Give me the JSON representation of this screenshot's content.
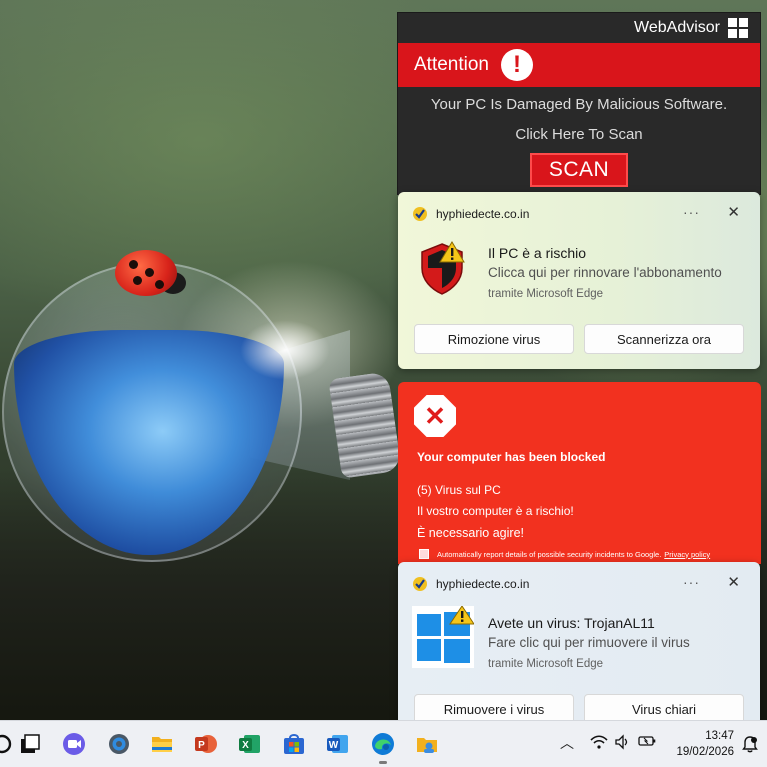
{
  "webadvisor": {
    "brand": "WebAdvisor",
    "attention": "Attention",
    "line1": "Your PC Is Damaged By Malicious Software.",
    "line2": "Click Here To Scan",
    "scan_label": "SCAN",
    "colors": {
      "panel": "#292929",
      "red": "#d9151b"
    }
  },
  "toast1": {
    "domain": "hyphiedecte.co.in",
    "title": "Il PC è a rischio",
    "subtitle": "Clicca qui per rinnovare l'abbonamento",
    "via": "tramite Microsoft Edge",
    "button1": "Rimozione virus",
    "button2": "Scannerizza ora",
    "icon": "shield-warning-icon"
  },
  "blocked": {
    "title": "Your computer has been blocked",
    "line1": "(5) Virus sul PC",
    "line2": "Il vostro computer è a rischio!",
    "line3": "È necessario agire!",
    "report_text": "Automatically report details of possible security incidents to Google.",
    "privacy_link": "Privacy policy",
    "color": "#f2311f"
  },
  "toast2": {
    "domain": "hyphiedecte.co.in",
    "title": "Avete un virus: TrojanAL11",
    "subtitle": "Fare clic qui per rimuovere il virus",
    "via": "tramite Microsoft Edge",
    "button1": "Rimuovere i virus",
    "button2": "Virus chiari",
    "icon": "windows-warning-icon"
  },
  "taskbar": {
    "time": "13:47",
    "date": "19/02/2026",
    "apps": [
      "search-icon",
      "task-view-icon",
      "meet-icon",
      "settings-icon",
      "file-explorer-icon",
      "powerpoint-icon",
      "excel-icon",
      "store-icon",
      "word-icon",
      "edge-icon",
      "folder-user-icon"
    ]
  }
}
